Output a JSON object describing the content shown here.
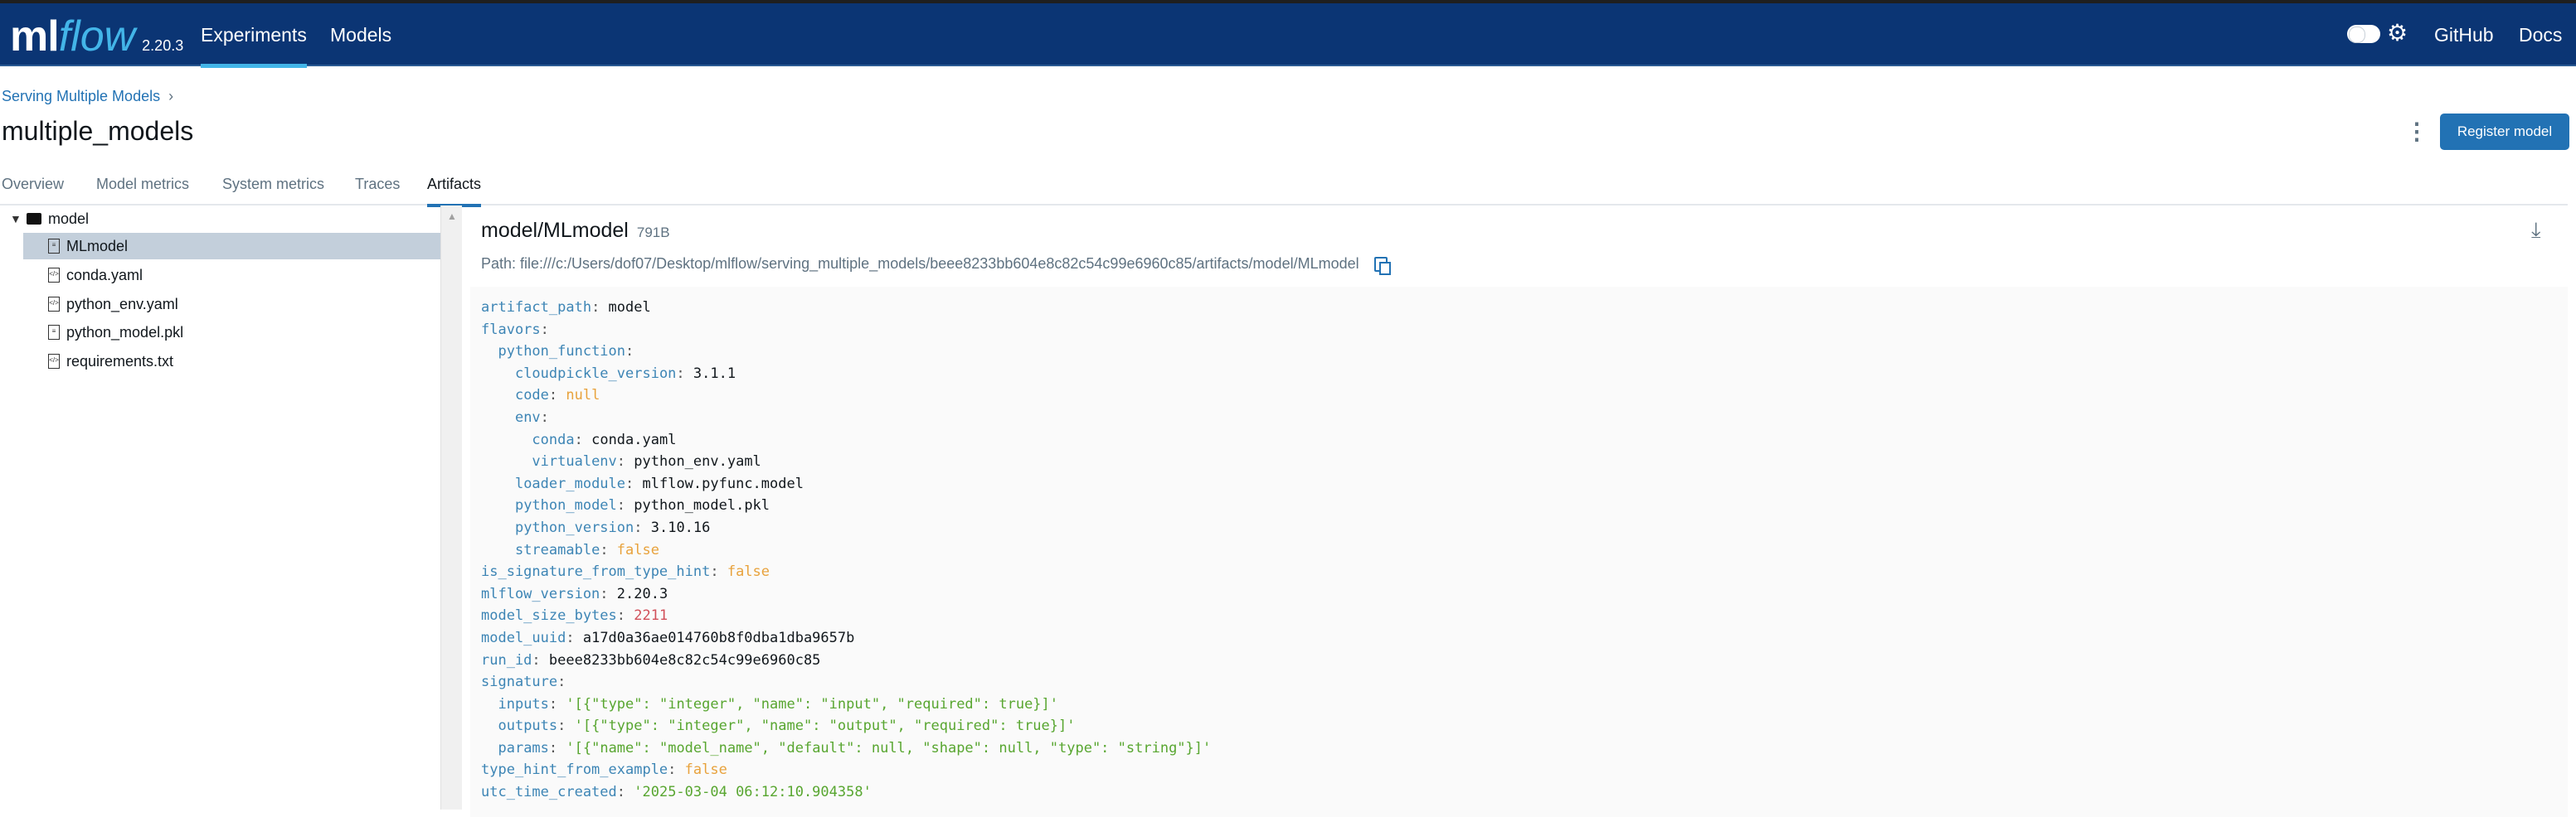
{
  "header": {
    "logo_ml": "ml",
    "logo_flow": "flow",
    "version": "2.20.3",
    "nav": [
      "Experiments",
      "Models"
    ],
    "active_nav": "Experiments",
    "right_links": [
      "GitHub",
      "Docs"
    ],
    "accent": "#0b3574"
  },
  "breadcrumb": "Serving Multiple Models",
  "title": "multiple_models",
  "register_label": "Register model",
  "tabs": [
    "Overview",
    "Model metrics",
    "System metrics",
    "Traces",
    "Artifacts"
  ],
  "active_tab": "Artifacts",
  "tree": {
    "folder": "model",
    "files": [
      "MLmodel",
      "conda.yaml",
      "python_env.yaml",
      "python_model.pkl",
      "requirements.txt"
    ],
    "selected": "MLmodel"
  },
  "file": {
    "name": "model/MLmodel",
    "size": "791B",
    "path": "Path: file:///c:/Users/dof07/Desktop/mlflow/serving_multiple_models/beee8233bb604e8c82c54c99e6960c85/artifacts/model/MLmodel"
  },
  "code": [
    {
      "i": 0,
      "k": "artifact_path",
      "v": "model",
      "t": "v"
    },
    {
      "i": 0,
      "k": "flavors",
      "v": "",
      "t": "v"
    },
    {
      "i": 1,
      "k": "python_function",
      "v": "",
      "t": "v"
    },
    {
      "i": 2,
      "k": "cloudpickle_version",
      "v": "3.1.1",
      "t": "v"
    },
    {
      "i": 2,
      "k": "code",
      "v": "null",
      "t": "b"
    },
    {
      "i": 2,
      "k": "env",
      "v": "",
      "t": "v"
    },
    {
      "i": 3,
      "k": "conda",
      "v": "conda.yaml",
      "t": "v"
    },
    {
      "i": 3,
      "k": "virtualenv",
      "v": "python_env.yaml",
      "t": "v"
    },
    {
      "i": 2,
      "k": "loader_module",
      "v": "mlflow.pyfunc.model",
      "t": "v"
    },
    {
      "i": 2,
      "k": "python_model",
      "v": "python_model.pkl",
      "t": "v"
    },
    {
      "i": 2,
      "k": "python_version",
      "v": "3.10.16",
      "t": "v"
    },
    {
      "i": 2,
      "k": "streamable",
      "v": "false",
      "t": "b"
    },
    {
      "i": 0,
      "k": "is_signature_from_type_hint",
      "v": "false",
      "t": "b"
    },
    {
      "i": 0,
      "k": "mlflow_version",
      "v": "2.20.3",
      "t": "v"
    },
    {
      "i": 0,
      "k": "model_size_bytes",
      "v": "2211",
      "t": "n"
    },
    {
      "i": 0,
      "k": "model_uuid",
      "v": "a17d0a36ae014760b8f0dba1dba9657b",
      "t": "v"
    },
    {
      "i": 0,
      "k": "run_id",
      "v": "beee8233bb604e8c82c54c99e6960c85",
      "t": "v"
    },
    {
      "i": 0,
      "k": "signature",
      "v": "",
      "t": "v"
    },
    {
      "i": 1,
      "k": "inputs",
      "v": "'[{\"type\": \"integer\", \"name\": \"input\", \"required\": true}]'",
      "t": "s"
    },
    {
      "i": 1,
      "k": "outputs",
      "v": "'[{\"type\": \"integer\", \"name\": \"output\", \"required\": true}]'",
      "t": "s"
    },
    {
      "i": 1,
      "k": "params",
      "v": "'[{\"name\": \"model_name\", \"default\": null, \"shape\": null, \"type\": \"string\"}]'",
      "t": "s"
    },
    {
      "i": 0,
      "k": "type_hint_from_example",
      "v": "false",
      "t": "b"
    },
    {
      "i": 0,
      "k": "utc_time_created",
      "v": "'2025-03-04 06:12:10.904358'",
      "t": "s"
    }
  ]
}
